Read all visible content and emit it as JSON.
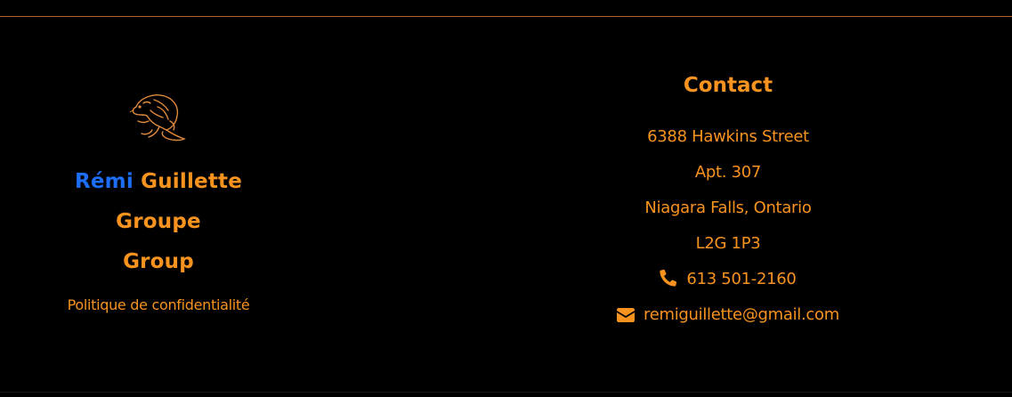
{
  "colors": {
    "accent": "#f7931e",
    "brand_blue": "#1e6ef5",
    "background": "#000000"
  },
  "brand": {
    "logo_icon": "beaver-icon",
    "name_first": "Rémi",
    "name_last": "Guillette",
    "line2": "Groupe",
    "line3": "Group"
  },
  "footer": {
    "privacy_link": "Politique de confidentialité"
  },
  "contact": {
    "heading": "Contact",
    "address_line1": "6388 Hawkins Street",
    "address_line2": "Apt. 307",
    "address_line3": "Niagara Falls, Ontario",
    "postal_code": "L2G 1P3",
    "phone_icon": "phone-icon",
    "phone": "613 501-2160",
    "email_icon": "envelope-icon",
    "email": "remiguillette@gmail.com"
  }
}
